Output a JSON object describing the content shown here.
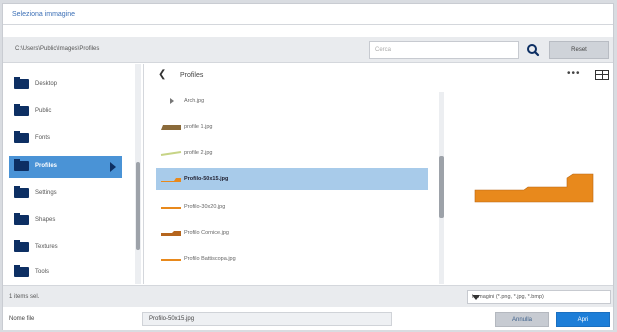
{
  "window": {
    "title": "Seleziona immagine"
  },
  "pathbar": {
    "path": "C:\\Users\\Public\\Images\\Profiles",
    "search_placeholder": "Cerca",
    "search_icon": "search-icon",
    "reset_label": "Reset"
  },
  "sidebar": {
    "items": [
      {
        "label": "Desktop",
        "selected": false
      },
      {
        "label": "Public",
        "selected": false
      },
      {
        "label": "Fonts",
        "selected": false
      },
      {
        "label": "Profiles",
        "selected": true
      },
      {
        "label": "Settings",
        "selected": false
      },
      {
        "label": "Shapes",
        "selected": false
      },
      {
        "label": "Textures",
        "selected": false
      },
      {
        "label": "Tools",
        "selected": false
      }
    ]
  },
  "filepane": {
    "folder": "Profiles",
    "files": [
      {
        "name": "Arch.jpg",
        "thumb": "arrow",
        "selected": false
      },
      {
        "name": "profile 1.jpg",
        "thumb": "brown",
        "selected": false
      },
      {
        "name": "profile 2.jpg",
        "thumb": "green",
        "selected": false
      },
      {
        "name": "Profilo-50x15.jpg",
        "thumb": "orange",
        "selected": true
      },
      {
        "name": "Profilo-30x20.jpg",
        "thumb": "orange",
        "selected": false
      },
      {
        "name": "Profilo Cornice.jpg",
        "thumb": "brown",
        "selected": false
      },
      {
        "name": "Profilo Battiscopa.jpg",
        "thumb": "orange",
        "selected": false
      }
    ]
  },
  "preview": {
    "more_label": "•••",
    "preview_color": "#e8891c"
  },
  "status": {
    "count": "1 items sel.",
    "filter": "Immagini (*.png, *.jpg, *.bmp)"
  },
  "footer": {
    "name_label": "Nome file",
    "name_value": "Profilo-50x15.jpg",
    "cancel_label": "Annulla",
    "open_label": "Apri"
  },
  "colors": {
    "accent": "#1d7ed8",
    "selection": "#4a93d6",
    "folder": "#0d2f63"
  }
}
